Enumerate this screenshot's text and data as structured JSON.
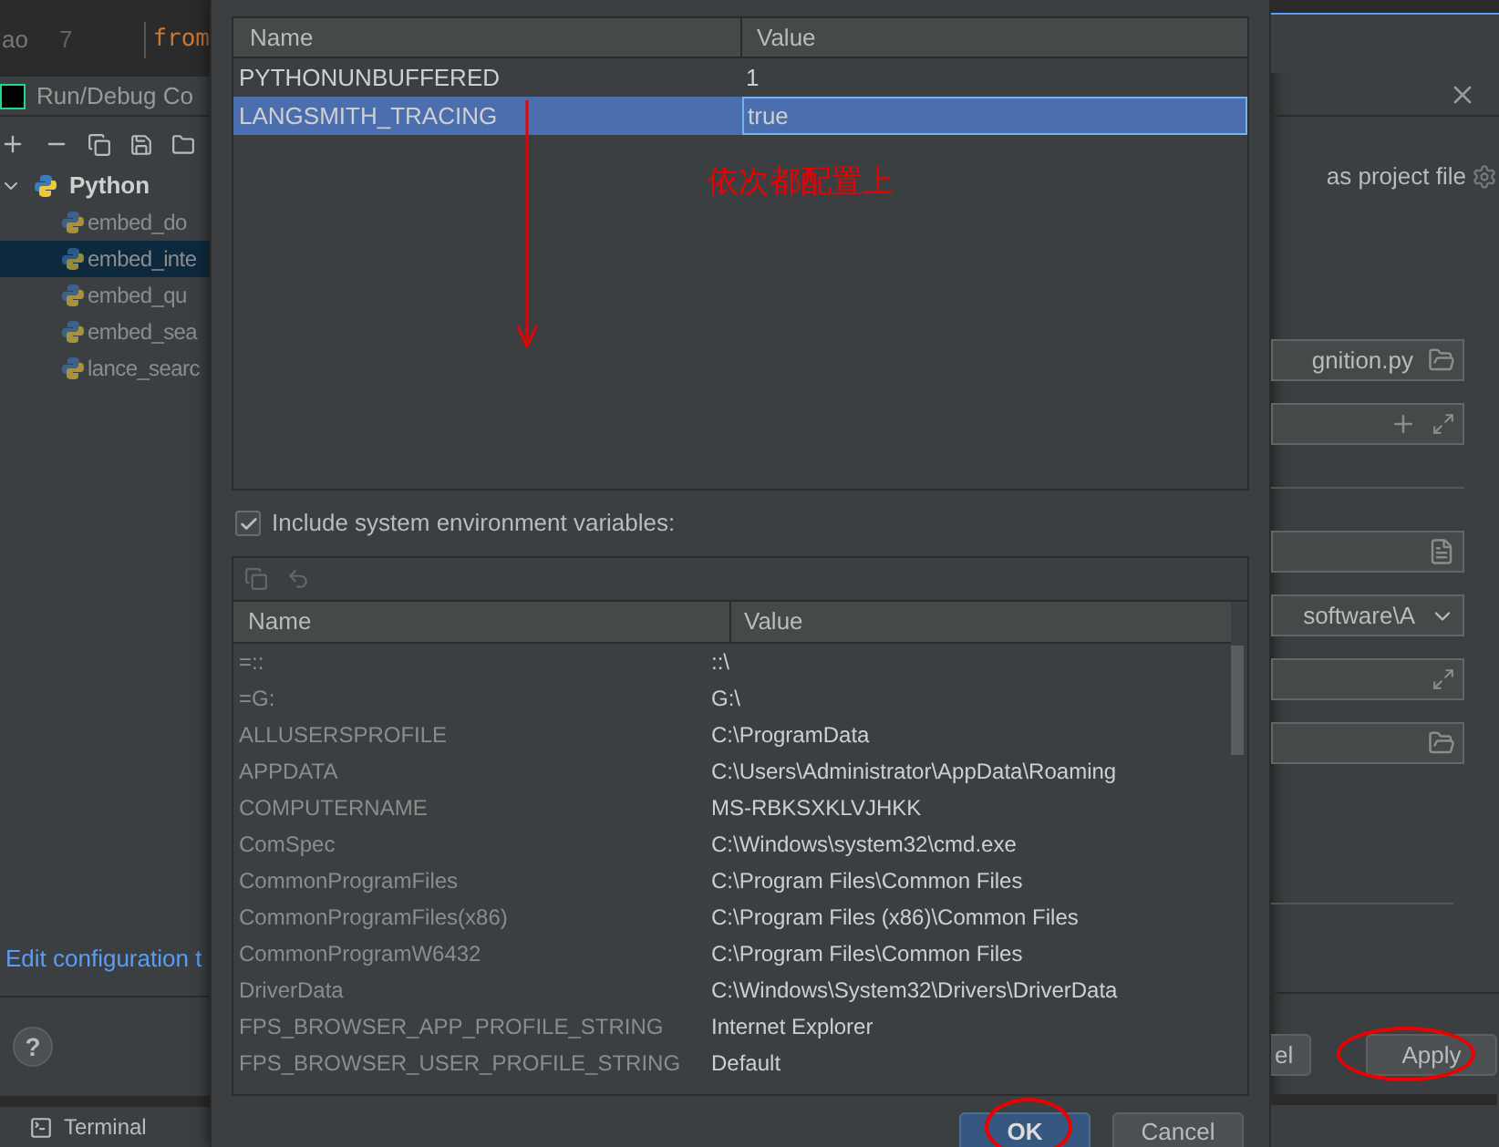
{
  "background_editor": {
    "gutter_text": "ao",
    "line_number": "7",
    "code": "from"
  },
  "background_dialog": {
    "title": "Run/Debug Co",
    "tree": {
      "label": "Python",
      "expanded": true,
      "children": [
        {
          "label": "embed_do",
          "selected": false
        },
        {
          "label": "embed_inte",
          "selected": true
        },
        {
          "label": "embed_qu",
          "selected": false
        },
        {
          "label": "embed_sea",
          "selected": false
        },
        {
          "label": "lance_searc",
          "selected": false
        }
      ]
    },
    "edit_link": "Edit configuration t",
    "help": "?",
    "store_option": "as project file",
    "fields": [
      {
        "kind": "file",
        "value": "gnition.py"
      },
      {
        "kind": "params"
      },
      {
        "kind": "gap"
      },
      {
        "kind": "doc"
      },
      {
        "kind": "dropdown",
        "value": "software\\A"
      },
      {
        "kind": "expand"
      },
      {
        "kind": "folder"
      }
    ],
    "buttons": [
      {
        "label": "el"
      },
      {
        "label": "Apply"
      }
    ]
  },
  "status_bar": {
    "tab": "Terminal"
  },
  "env_dialog": {
    "user_table": {
      "columns": [
        "Name",
        "Value"
      ],
      "rows": [
        {
          "name": "PYTHONUNBUFFERED",
          "value": "1",
          "selected": false
        },
        {
          "name": "LANGSMITH_TRACING",
          "value": "true",
          "selected": true
        }
      ]
    },
    "include_system": {
      "label": "Include system environment variables:",
      "checked": true
    },
    "system_table": {
      "columns": [
        "Name",
        "Value"
      ],
      "rows": [
        {
          "name": "=::",
          "value": "::\\"
        },
        {
          "name": "=G:",
          "value": "G:\\"
        },
        {
          "name": "ALLUSERSPROFILE",
          "value": "C:\\ProgramData"
        },
        {
          "name": "APPDATA",
          "value": "C:\\Users\\Administrator\\AppData\\Roaming"
        },
        {
          "name": "COMPUTERNAME",
          "value": "MS-RBKSXKLVJHKK"
        },
        {
          "name": "ComSpec",
          "value": "C:\\Windows\\system32\\cmd.exe"
        },
        {
          "name": "CommonProgramFiles",
          "value": "C:\\Program Files\\Common Files"
        },
        {
          "name": "CommonProgramFiles(x86)",
          "value": "C:\\Program Files (x86)\\Common Files"
        },
        {
          "name": "CommonProgramW6432",
          "value": "C:\\Program Files\\Common Files"
        },
        {
          "name": "DriverData",
          "value": "C:\\Windows\\System32\\Drivers\\DriverData"
        },
        {
          "name": "FPS_BROWSER_APP_PROFILE_STRING",
          "value": "Internet Explorer"
        },
        {
          "name": "FPS_BROWSER_USER_PROFILE_STRING",
          "value": "Default"
        }
      ]
    },
    "buttons": [
      {
        "label": "OK",
        "kind": "primary"
      },
      {
        "label": "Cancel",
        "kind": "secondary"
      }
    ]
  },
  "annotation": {
    "text": "依次都配置上"
  }
}
